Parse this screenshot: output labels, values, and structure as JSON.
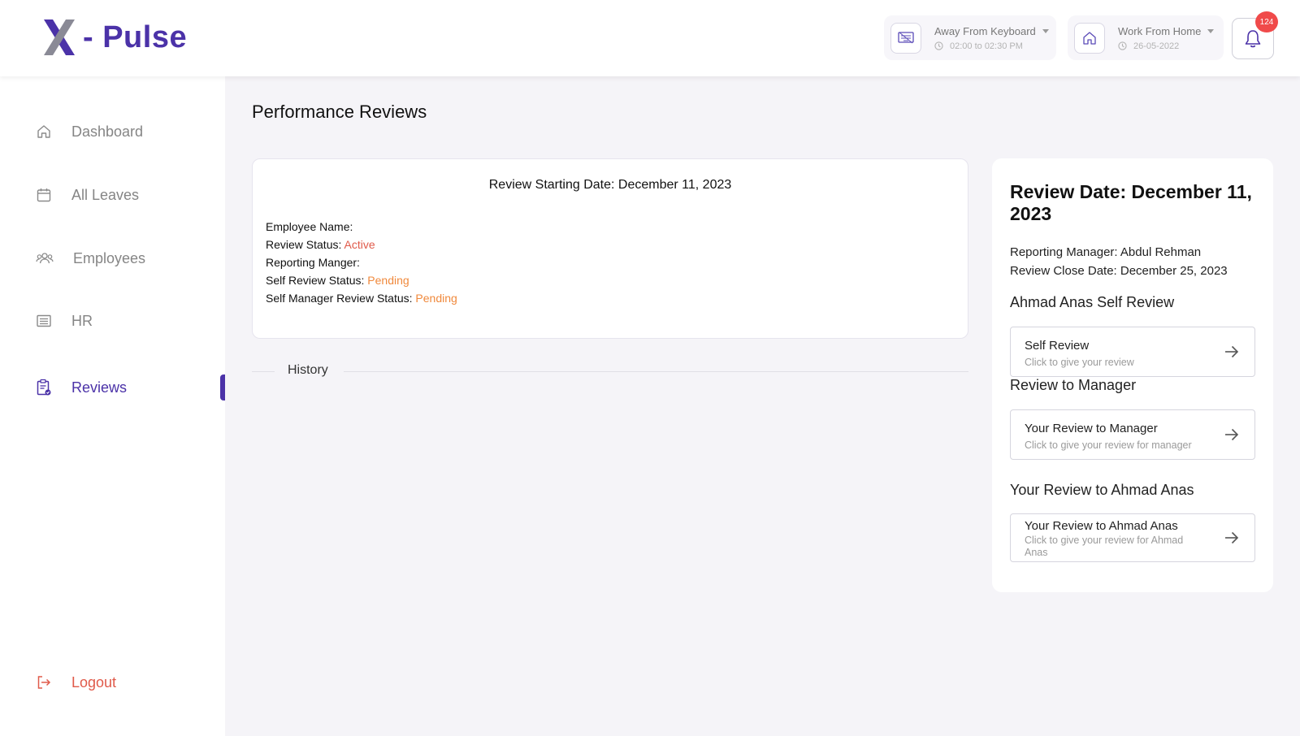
{
  "app": {
    "logo_text": "- Pulse"
  },
  "header": {
    "status_afk": {
      "title": "Away From Keyboard",
      "time": "02:00 to 02:30 PM"
    },
    "status_wfh": {
      "title": "Work From Home",
      "date": "26-05-2022"
    },
    "notifications": {
      "count": "124"
    }
  },
  "sidebar": {
    "items": [
      {
        "label": "Dashboard",
        "icon": "home-icon"
      },
      {
        "label": "All Leaves",
        "icon": "calendar-icon"
      },
      {
        "label": "Employees",
        "icon": "users-icon"
      },
      {
        "label": "HR",
        "icon": "list-icon"
      },
      {
        "label": "Reviews",
        "icon": "clipboard-icon",
        "active": true
      }
    ],
    "logout": {
      "label": "Logout",
      "icon": "logout-icon"
    }
  },
  "main": {
    "page_title": "Performance Reviews",
    "review_card": {
      "title": "Review Starting Date: December 11, 2023",
      "employee_name_label": "Employee Name:",
      "review_status_label": "Review Status:",
      "review_status_value": "Active",
      "reporting_manager_label": "Reporting Manger:",
      "self_review_status_label": "Self Review Status:",
      "self_review_status_value": "Pending",
      "self_manager_review_status_label": "Self Manager Review Status:",
      "self_manager_review_status_value": "Pending"
    },
    "history_label": "History"
  },
  "right_panel": {
    "title": "Review Date: December 11, 2023",
    "reporting_manager": "Reporting Manager: Abdul Rehman",
    "review_close_date": "Review Close Date: December 25, 2023",
    "sections": [
      {
        "heading": "Ahmad Anas Self Review",
        "button_title": "Self Review",
        "button_sub": "Click to give your review"
      },
      {
        "heading": "Review to Manager",
        "button_title": "Your Review to Manager",
        "button_sub": "Click to give your review for manager"
      },
      {
        "heading": "Your Review to Ahmad Anas",
        "button_title": "Your Review to Ahmad Anas",
        "button_sub": "Click to give your review for Ahmad Anas"
      }
    ]
  },
  "colors": {
    "brand": "#4b32a8",
    "active_status": "#e05a4a",
    "pending_status": "#f0893c",
    "badge": "#f04a4a"
  }
}
